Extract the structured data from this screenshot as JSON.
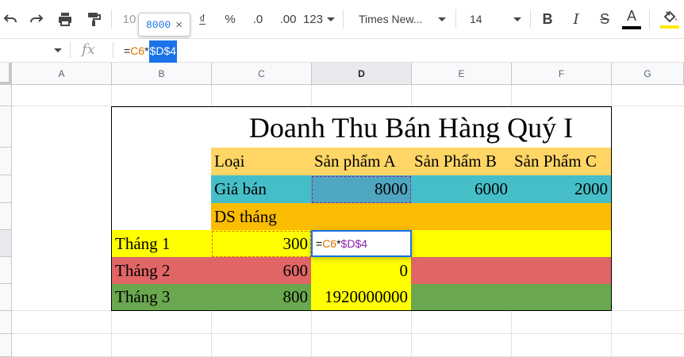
{
  "toolbar": {
    "zoom_partial": "10",
    "currency_symbol": "₫",
    "percent_symbol": "%",
    "decrease_decimal": ".0",
    "increase_decimal": ".00",
    "number_format": "123",
    "font_name": "Times New...",
    "font_size": "14",
    "bold_label": "B",
    "italic_label": "I",
    "strike_label": "S",
    "text_color_label": "A",
    "colors": {
      "text_color_bar": "#000000",
      "fill_color_bar": "#fbe900"
    }
  },
  "tooltip": {
    "value": "8000",
    "close": "×"
  },
  "formula_bar": {
    "fx": "fx",
    "eq": "=",
    "ref1": "C6",
    "op": "*",
    "ref2": "$D$4"
  },
  "columns": [
    "A",
    "B",
    "C",
    "D",
    "E",
    "F",
    "G"
  ],
  "sheet": {
    "title": "Doanh Thu Bán Hàng Quý I",
    "header_row": {
      "label": "Loại",
      "a": "Sản phẩm A",
      "b": "Sản Phẩm B",
      "c": "Sản Phẩm C"
    },
    "price_row": {
      "label": "Giá bán",
      "a": "8000",
      "b": "6000",
      "c": "2000"
    },
    "ds_row": {
      "label": "DS tháng"
    },
    "months": [
      {
        "label": "Tháng 1",
        "qty": "300"
      },
      {
        "label": "Tháng 2",
        "qty": "600",
        "a": "0"
      },
      {
        "label": "Tháng 3",
        "qty": "800",
        "a": "1920000000"
      }
    ],
    "editor": {
      "eq": "=",
      "ref1": "C6",
      "op": "*",
      "ref2": "$D$4"
    }
  },
  "colors": {
    "header_bg": "#ffd666",
    "price_bg": "#45bec7",
    "price_sel_bg": "#4fa6c0",
    "ds_bg": "#fbbc04",
    "month1_bg": "#ffff00",
    "month2_bg": "#e06666",
    "month3_bg": "#6aa84f",
    "selection": "#1a73e8"
  }
}
